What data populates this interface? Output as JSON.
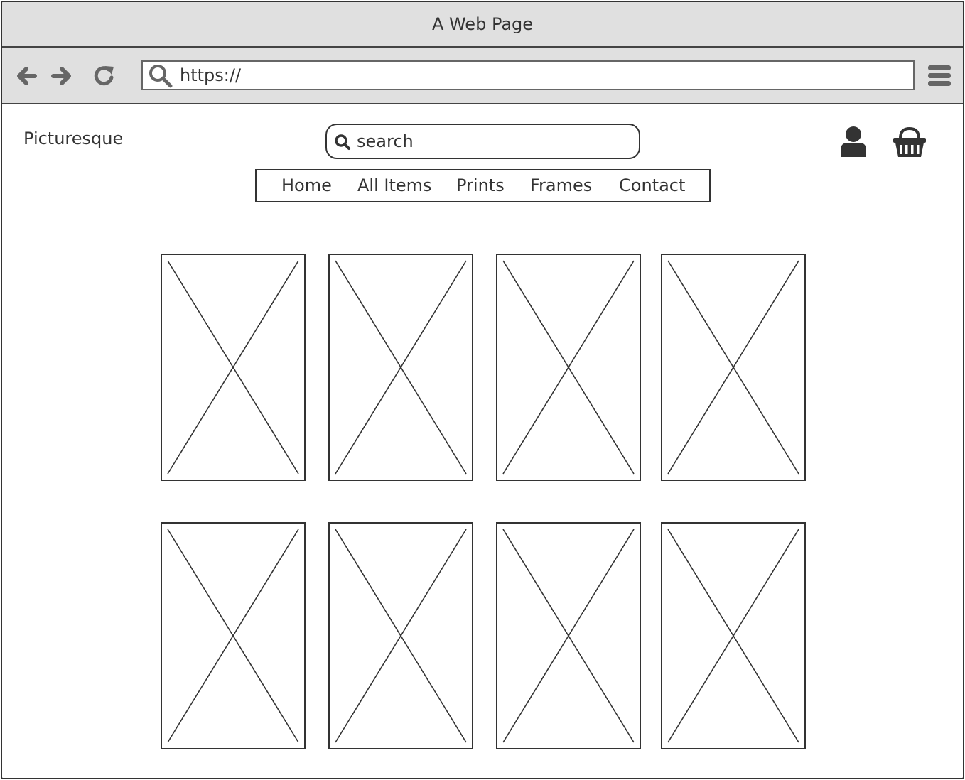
{
  "window": {
    "title": "A Web Page"
  },
  "browser": {
    "url": "https://",
    "icons": [
      "back-arrow-icon",
      "forward-arrow-icon",
      "refresh-icon",
      "search-icon",
      "menu-icon"
    ]
  },
  "site": {
    "brand": "Picturesque",
    "search": {
      "placeholder": "search"
    },
    "nav": [
      {
        "label": "Home"
      },
      {
        "label": "All Items"
      },
      {
        "label": "Prints"
      },
      {
        "label": "Frames"
      },
      {
        "label": "Contact"
      }
    ],
    "icons": [
      "user-icon",
      "basket-icon"
    ]
  },
  "gallery": {
    "rows": 2,
    "columns": 4,
    "items": [
      {
        "type": "image-placeholder"
      },
      {
        "type": "image-placeholder"
      },
      {
        "type": "image-placeholder"
      },
      {
        "type": "image-placeholder"
      },
      {
        "type": "image-placeholder"
      },
      {
        "type": "image-placeholder"
      },
      {
        "type": "image-placeholder"
      },
      {
        "type": "image-placeholder"
      }
    ]
  }
}
